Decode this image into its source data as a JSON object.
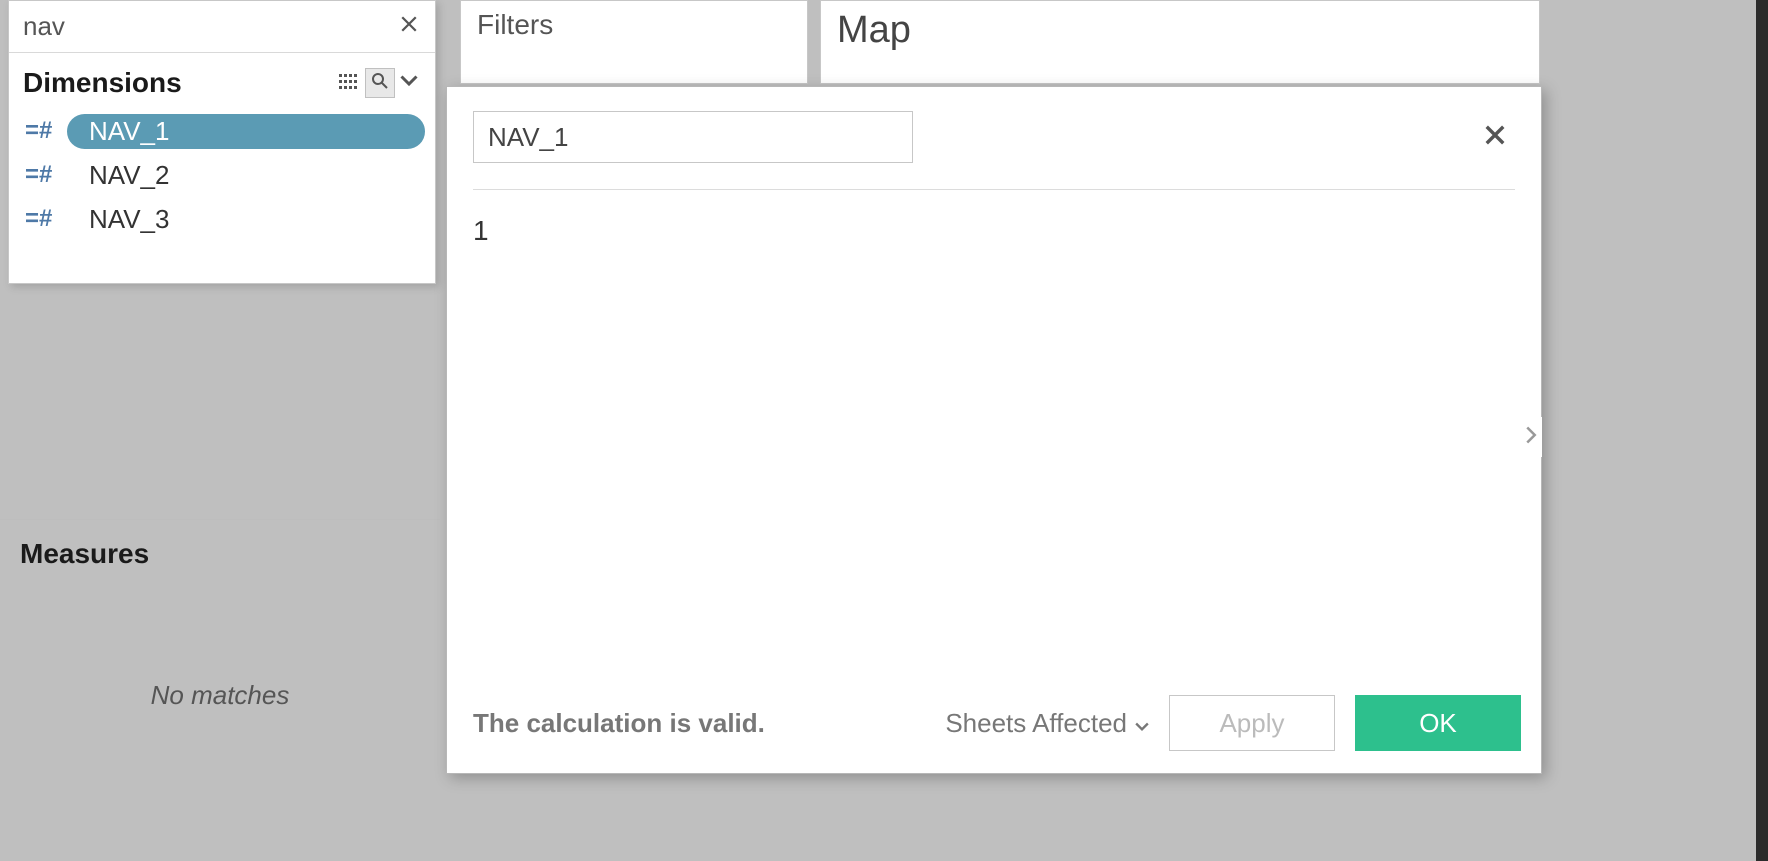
{
  "search": {
    "value": "nav"
  },
  "dimensions": {
    "title": "Dimensions",
    "items": [
      {
        "label": "NAV_1",
        "selected": true
      },
      {
        "label": "NAV_2",
        "selected": false
      },
      {
        "label": "NAV_3",
        "selected": false
      }
    ]
  },
  "measures": {
    "title": "Measures",
    "no_matches": "No matches"
  },
  "shelves": {
    "filters_label": "Filters",
    "map_label": "Map"
  },
  "calc": {
    "name": "NAV_1",
    "formula": "1",
    "status": "The calculation is valid.",
    "sheets_affected_label": "Sheets Affected",
    "apply_label": "Apply",
    "ok_label": "OK"
  }
}
